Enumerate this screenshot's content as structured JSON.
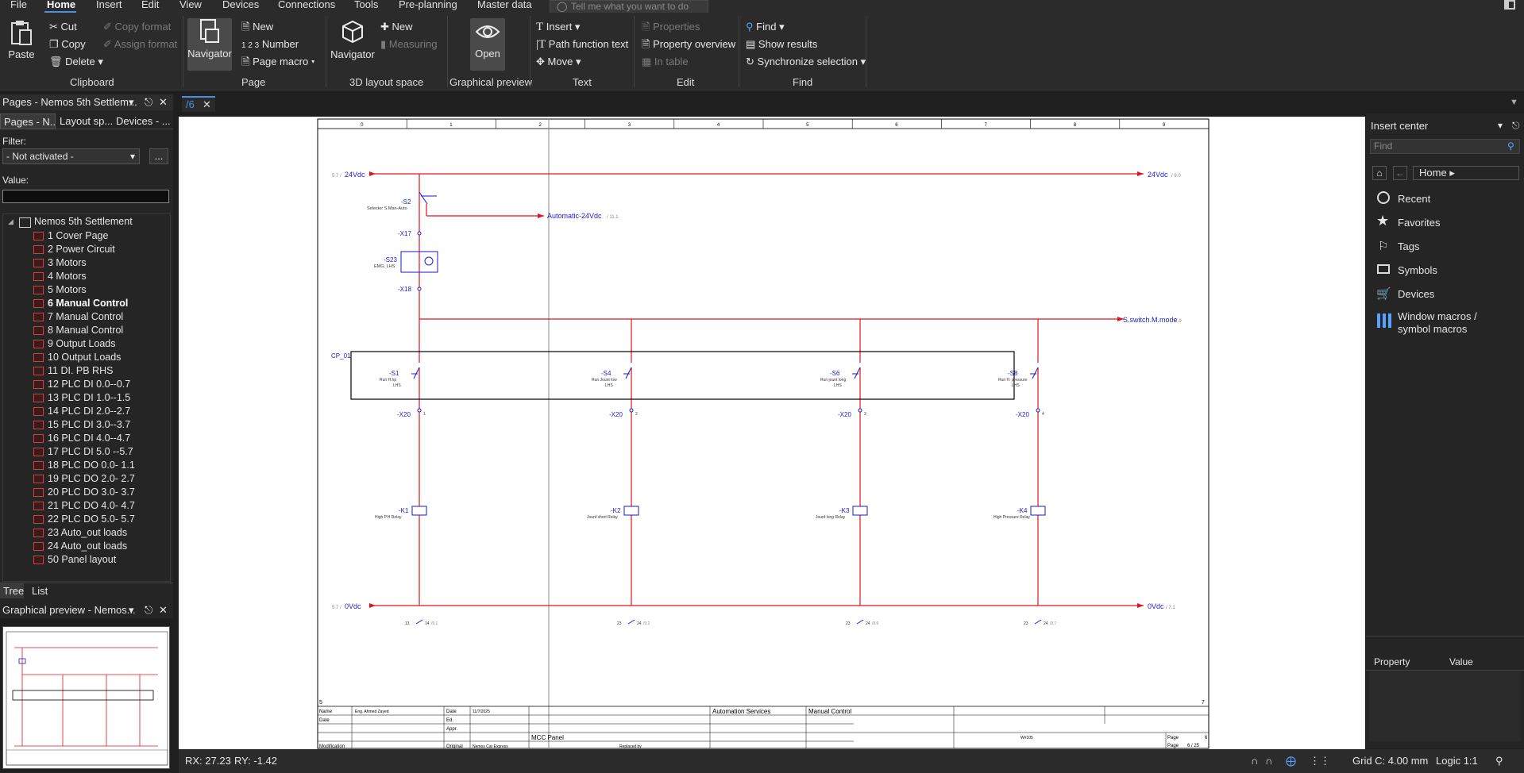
{
  "menubar": {
    "items": [
      {
        "label": "File"
      },
      {
        "label": "Home"
      },
      {
        "label": "Insert"
      },
      {
        "label": "Edit"
      },
      {
        "label": "View"
      },
      {
        "label": "Devices"
      },
      {
        "label": "Connections"
      },
      {
        "label": "Tools"
      },
      {
        "label": "Pre-planning"
      },
      {
        "label": "Master data"
      }
    ],
    "tell_me_placeholder": "Tell me what you want to do"
  },
  "ribbon": {
    "clipboard": {
      "paste": "Paste",
      "cut": "Cut",
      "copy": "Copy",
      "delete": "Delete",
      "copy_format": "Copy format",
      "assign_format": "Assign format",
      "group": "Clipboard"
    },
    "page": {
      "navigator": "Navigator",
      "new": "New",
      "number": "Number",
      "page_macro": "Page macro",
      "group": "Page"
    },
    "layout3d": {
      "navigator": "Navigator",
      "new": "New",
      "measuring": "Measuring",
      "group": "3D layout space"
    },
    "preview": {
      "open": "Open",
      "group": "Graphical preview"
    },
    "text": {
      "insert": "Insert",
      "path_function_text": "Path function text",
      "move": "Move",
      "group": "Text"
    },
    "edit": {
      "properties": "Properties",
      "property_overview": "Property overview",
      "in_table": "In table",
      "group": "Edit"
    },
    "find": {
      "find": "Find",
      "show_results": "Show results",
      "synchronize_selection": "Synchronize selection",
      "group": "Find"
    }
  },
  "pages_panel": {
    "title": "Pages - Nemos 5th Settlem...",
    "tabs": [
      "Pages - N...",
      "Layout sp...",
      "Devices - ..."
    ],
    "filter_label": "Filter:",
    "filter_value": "- Not activated -",
    "filter_more": "...",
    "value_label": "Value:",
    "root": "Nemos 5th Settlement",
    "pages": [
      "1 Cover Page",
      "2 Power Circuit",
      "3 Motors",
      "4 Motors",
      "5 Motors",
      "6 Manual Control",
      "7 Manual Control",
      "8 Manual Control",
      "9 Output Loads",
      "10 Output Loads",
      "11 DI. PB RHS",
      "12 PLC DI 0.0--0.7",
      "13 PLC DI 1.0--1.5",
      "14 PLC DI 2.0--2.7",
      "15 PLC DI 3.0--3.7",
      "16 PLC DI 4.0--4.7",
      "17 PLC DI 5.0 --5.7",
      "18 PLC DO 0.0- 1.1",
      "19 PLC DO 2.0- 2.7",
      "20 PLC DO 3.0- 3.7",
      "21 PLC DO 4.0- 4.7",
      "22 PLC DO 5.0- 5.7",
      "23 Auto_out loads",
      "24 Auto_out loads",
      "50 Panel layout"
    ],
    "selected_index": 5,
    "bottom_tabs": [
      "Tree",
      "List"
    ]
  },
  "preview_panel": {
    "title": "Graphical preview - Nemos..."
  },
  "document_tab": {
    "label": "/6"
  },
  "drawing": {
    "col_numbers": [
      "0",
      "1",
      "2",
      "3",
      "4",
      "5",
      "6",
      "7",
      "8",
      "9"
    ],
    "top_left_ref": "5.7 /",
    "top_left_label": "24Vdc",
    "top_right_label": "24Vdc",
    "top_right_ref": "/ 9.0",
    "bottom_left_ref": "5.7 /",
    "bottom_left_label": "0Vdc",
    "bottom_right_label": "0Vdc",
    "bottom_right_ref": "/ 7.1",
    "auto_label": "Automatic-24Vdc",
    "auto_ref": "/ 11.1",
    "sswitch_label": "S.switch.M.mode",
    "sswitch_ref": "/ 7.9",
    "s2_tag": "-S2",
    "s2_desc": "Selector S.Man-Auto",
    "x17": "-X17",
    "s23_tag": "-S23",
    "s23_desc": "EMG. LHS",
    "x18": "-X18",
    "cp": "CP_01",
    "branches": [
      {
        "switch": "-S1",
        "desc1": "Run H.hp",
        "desc2": "LHS",
        "x": "-X20",
        "term": "1",
        "relay": "-K1",
        "relay_desc": "High P.H Relay",
        "aux": "13",
        "aux2": "14",
        "ref": "/9.1"
      },
      {
        "switch": "-S4",
        "desc1": "Run Jount low",
        "desc2": "LHS",
        "x": "-X20",
        "term": "2",
        "relay": "-K2",
        "relay_desc": "Jount short Relay",
        "aux": "23",
        "aux2": "24",
        "ref": "/9.2"
      },
      {
        "switch": "-S6",
        "desc1": "Run jount long",
        "desc2": "LHS",
        "x": "-X20",
        "term": "3",
        "relay": "-K3",
        "relay_desc": "Jount long Relay",
        "aux": "23",
        "aux2": "24",
        "ref": "/9.6"
      },
      {
        "switch": "-S8",
        "desc1": "Run H. pressure",
        "desc2": "LHS",
        "x": "-X20",
        "term": "4",
        "relay": "-K4",
        "relay_desc": "High Pressure Relay",
        "aux": "23",
        "aux2": "24",
        "ref": "/9.7"
      }
    ],
    "title_block": {
      "name_label": "Name",
      "name_value": "Eng. Ahmed Zayed",
      "date_label": "Date",
      "date_value": "11/7/2025",
      "ed_label": "Ed.",
      "appr_label": "Appr.",
      "modification_label": "Modification",
      "original_label": "Original",
      "original_value": "Nemos Car Express",
      "replaced_label": "Replaced by",
      "company": "Automation Services",
      "project": "MCC Panel",
      "page_title": "Manual Control",
      "drawing_no": "W#105",
      "page_label": "Page",
      "page_value": "6",
      "page_of": "6 / 25",
      "left_num": "5",
      "right_num": "7"
    }
  },
  "insert_center": {
    "title": "Insert center",
    "find_placeholder": "Find",
    "home": "Home",
    "items": [
      "Recent",
      "Favorites",
      "Tags",
      "Symbols",
      "Devices",
      "Window macros /",
      "symbol macros"
    ],
    "property_header": "Property",
    "value_header": "Value"
  },
  "statusbar": {
    "rx": "RX: 27.23",
    "ry": "RY: -1.42",
    "grid": "Grid C: 4.00 mm",
    "logic": "Logic 1:1"
  },
  "colors": {
    "wire": "#e0141e",
    "label_blue": "#1a1ad0",
    "accent": "#4a90e2"
  }
}
